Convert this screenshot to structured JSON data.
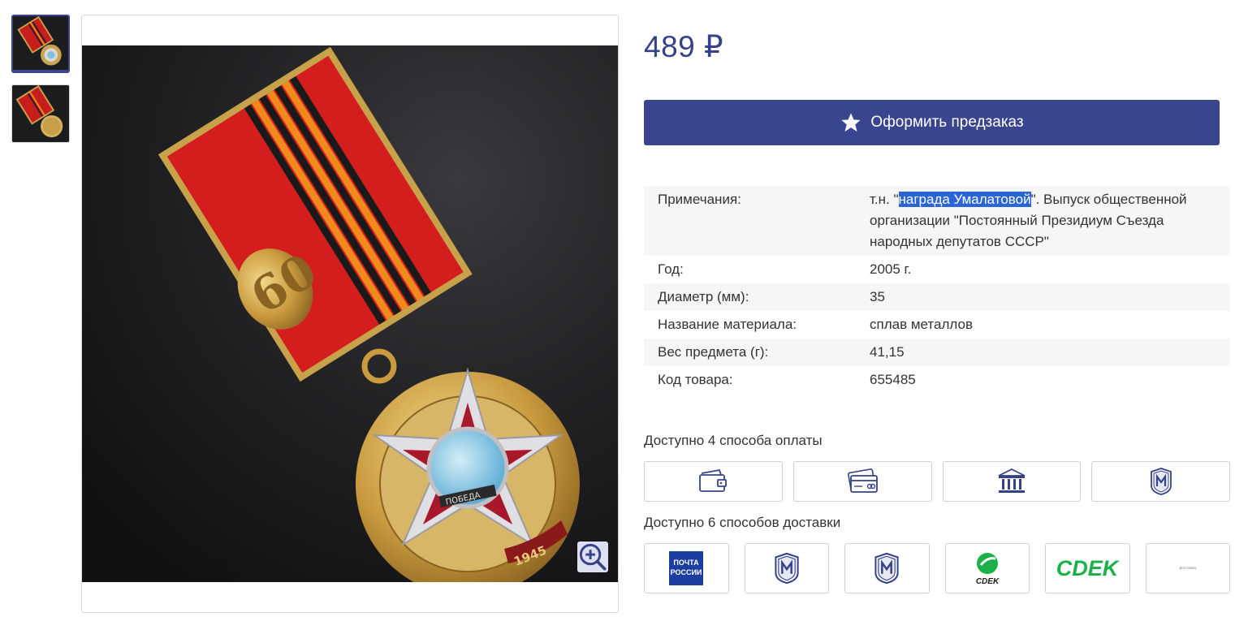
{
  "product": {
    "price": "489 ₽",
    "preorder_label": "Оформить предзаказ"
  },
  "specs": [
    {
      "key": "Примечания:",
      "value_pre": "т.н. \"",
      "value_hl": "награда Умалатовой",
      "value_post": "\". Выпуск общественной организации \"Постоянный Президиум Съезда народных депутатов СССР\""
    },
    {
      "key": "Год:",
      "value": "2005 г."
    },
    {
      "key": "Диаметр (мм):",
      "value": "35"
    },
    {
      "key": "Название материала:",
      "value": "сплав металлов"
    },
    {
      "key": "Вес предмета (г):",
      "value": "41,15"
    },
    {
      "key": "Код товара:",
      "value": "655485"
    }
  ],
  "payment": {
    "title": "Доступно 4 способа оплаты",
    "icons": [
      "wallet-icon",
      "card-icon",
      "bank-icon",
      "shop-logo-icon"
    ]
  },
  "delivery": {
    "title": "Доступно 6 способов доставки",
    "items": [
      {
        "icon": "russian-post-logo",
        "logo_text": "ПОЧТА\nРОССИИ"
      },
      {
        "icon": "shop-logo-icon"
      },
      {
        "icon": "shop-logo-icon"
      },
      {
        "icon": "cdek-round-logo",
        "logo_text": "СDEK"
      },
      {
        "icon": "cdek-logo",
        "logo_text": "CDEK"
      },
      {
        "icon": "other-delivery-logo",
        "logo_text": "доставка"
      }
    ]
  },
  "colors": {
    "accent": "#3a4590",
    "price": "#35428a",
    "highlight": "#2a64d6",
    "cdek_green": "#1ab248",
    "post_blue": "#1a3fa0"
  }
}
